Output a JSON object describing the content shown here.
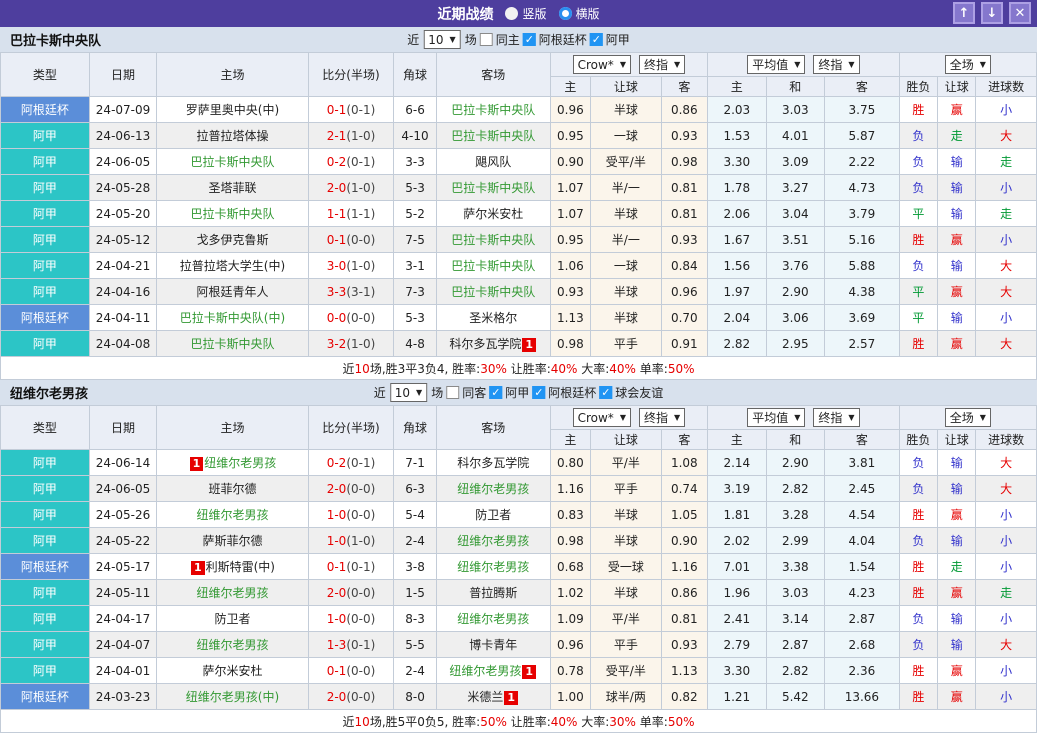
{
  "titlebar": {
    "title": "近期战绩",
    "radios": [
      {
        "label": "竖版",
        "selected": false
      },
      {
        "label": "横版",
        "selected": true
      }
    ],
    "buttons": {
      "up": "↑",
      "down": "↓",
      "close": "✕"
    }
  },
  "headers": {
    "type": "类型",
    "date": "日期",
    "home": "主场",
    "score": "比分(半场)",
    "corner": "角球",
    "away": "客场",
    "dd_company": "Crow*",
    "dd_final1": "终指",
    "dd_avg": "平均值",
    "dd_final2": "终指",
    "dd_scope": "全场",
    "ah_home": "主",
    "ah_line": "让球",
    "ah_away": "客",
    "eu_home": "主",
    "eu_draw": "和",
    "eu_away": "客",
    "wl": "胜负",
    "ahr": "让球",
    "goals": "进球数"
  },
  "league_labels": {
    "cup": "阿根廷杯",
    "lig": "阿甲"
  },
  "colors": {
    "titlebar": "#4e3e9e",
    "cup_badge": "#5b8ed9",
    "league_badge": "#2cc5c6",
    "self_team_green": "#339933",
    "score_red": "#e60000",
    "win_red": "#e60000",
    "draw_green": "#009933",
    "lose_blue": "#3333cc",
    "ah_col_bg": "#fbf5eb",
    "eu_col_bg": "#edf6fa",
    "band_bg": "#d8e1ed",
    "checkbox_blue": "#2094f3"
  },
  "sections": [
    {
      "team": "巴拉卡斯中央队",
      "controls": {
        "near": "近",
        "count": "10",
        "games": "场",
        "same": {
          "label": "同主",
          "checked": false
        },
        "leagues": [
          {
            "label": "阿根廷杯",
            "checked": true
          },
          {
            "label": "阿甲",
            "checked": true
          }
        ]
      },
      "rows": [
        {
          "lg": "cup",
          "date": "24-07-09",
          "home": {
            "n": "罗萨里奥中央(中)"
          },
          "ft": "0-1",
          "ht": "(0-1)",
          "corner": "6-6",
          "away": {
            "n": "巴拉卡斯中央队",
            "self": true
          },
          "ah": [
            "0.96",
            "半球",
            "0.86"
          ],
          "eu": [
            "2.03",
            "3.03",
            "3.75"
          ],
          "res": [
            [
              "胜",
              "red"
            ],
            [
              "赢",
              "red"
            ],
            [
              "小",
              "blue"
            ]
          ]
        },
        {
          "lg": "lig",
          "date": "24-06-13",
          "home": {
            "n": "拉普拉塔体操"
          },
          "ft": "2-1",
          "ht": "(1-0)",
          "corner": "4-10",
          "away": {
            "n": "巴拉卡斯中央队",
            "self": true
          },
          "ah": [
            "0.95",
            "一球",
            "0.93"
          ],
          "eu": [
            "1.53",
            "4.01",
            "5.87"
          ],
          "res": [
            [
              "负",
              "blue"
            ],
            [
              "走",
              "green"
            ],
            [
              "大",
              "red"
            ]
          ]
        },
        {
          "lg": "lig",
          "date": "24-06-05",
          "home": {
            "n": "巴拉卡斯中央队",
            "self": true
          },
          "ft": "0-2",
          "ht": "(0-1)",
          "corner": "3-3",
          "away": {
            "n": "飓风队"
          },
          "ah": [
            "0.90",
            "受平/半",
            "0.98"
          ],
          "eu": [
            "3.30",
            "3.09",
            "2.22"
          ],
          "res": [
            [
              "负",
              "blue"
            ],
            [
              "输",
              "blue"
            ],
            [
              "走",
              "green"
            ]
          ]
        },
        {
          "lg": "lig",
          "date": "24-05-28",
          "home": {
            "n": "圣塔菲联"
          },
          "ft": "2-0",
          "ht": "(1-0)",
          "corner": "5-3",
          "away": {
            "n": "巴拉卡斯中央队",
            "self": true
          },
          "ah": [
            "1.07",
            "半/一",
            "0.81"
          ],
          "eu": [
            "1.78",
            "3.27",
            "4.73"
          ],
          "res": [
            [
              "负",
              "blue"
            ],
            [
              "输",
              "blue"
            ],
            [
              "小",
              "blue"
            ]
          ]
        },
        {
          "lg": "lig",
          "date": "24-05-20",
          "home": {
            "n": "巴拉卡斯中央队",
            "self": true
          },
          "ft": "1-1",
          "ht": "(1-1)",
          "corner": "5-2",
          "away": {
            "n": "萨尔米安杜"
          },
          "ah": [
            "1.07",
            "半球",
            "0.81"
          ],
          "eu": [
            "2.06",
            "3.04",
            "3.79"
          ],
          "res": [
            [
              "平",
              "green"
            ],
            [
              "输",
              "blue"
            ],
            [
              "走",
              "green"
            ]
          ]
        },
        {
          "lg": "lig",
          "date": "24-05-12",
          "home": {
            "n": "戈多伊克鲁斯"
          },
          "ft": "0-1",
          "ht": "(0-0)",
          "corner": "7-5",
          "away": {
            "n": "巴拉卡斯中央队",
            "self": true
          },
          "ah": [
            "0.95",
            "半/一",
            "0.93"
          ],
          "eu": [
            "1.67",
            "3.51",
            "5.16"
          ],
          "res": [
            [
              "胜",
              "red"
            ],
            [
              "赢",
              "red"
            ],
            [
              "小",
              "blue"
            ]
          ]
        },
        {
          "lg": "lig",
          "date": "24-04-21",
          "home": {
            "n": "拉普拉塔大学生(中)"
          },
          "ft": "3-0",
          "ht": "(1-0)",
          "corner": "3-1",
          "away": {
            "n": "巴拉卡斯中央队",
            "self": true
          },
          "ah": [
            "1.06",
            "一球",
            "0.84"
          ],
          "eu": [
            "1.56",
            "3.76",
            "5.88"
          ],
          "res": [
            [
              "负",
              "blue"
            ],
            [
              "输",
              "blue"
            ],
            [
              "大",
              "red"
            ]
          ]
        },
        {
          "lg": "lig",
          "date": "24-04-16",
          "home": {
            "n": "阿根廷青年人"
          },
          "ft": "3-3",
          "ht": "(3-1)",
          "corner": "7-3",
          "away": {
            "n": "巴拉卡斯中央队",
            "self": true
          },
          "ah": [
            "0.93",
            "半球",
            "0.96"
          ],
          "eu": [
            "1.97",
            "2.90",
            "4.38"
          ],
          "res": [
            [
              "平",
              "green"
            ],
            [
              "赢",
              "red"
            ],
            [
              "大",
              "red"
            ]
          ]
        },
        {
          "lg": "cup",
          "date": "24-04-11",
          "home": {
            "n": "巴拉卡斯中央队(中)",
            "self": true
          },
          "ft": "0-0",
          "ht": "(0-0)",
          "corner": "5-3",
          "away": {
            "n": "圣米格尔"
          },
          "ah": [
            "1.13",
            "半球",
            "0.70"
          ],
          "eu": [
            "2.04",
            "3.06",
            "3.69"
          ],
          "res": [
            [
              "平",
              "green"
            ],
            [
              "输",
              "blue"
            ],
            [
              "小",
              "blue"
            ]
          ]
        },
        {
          "lg": "lig",
          "date": "24-04-08",
          "home": {
            "n": "巴拉卡斯中央队",
            "self": true
          },
          "ft": "3-2",
          "ht": "(1-0)",
          "corner": "4-8",
          "away": {
            "n": "科尔多瓦学院",
            "card": "1"
          },
          "ah": [
            "0.98",
            "平手",
            "0.91"
          ],
          "eu": [
            "2.82",
            "2.95",
            "2.57"
          ],
          "res": [
            [
              "胜",
              "red"
            ],
            [
              "赢",
              "red"
            ],
            [
              "大",
              "red"
            ]
          ]
        }
      ],
      "summary": [
        [
          "近"
        ],
        [
          "10",
          "red"
        ],
        [
          "场,胜3平3负4, 胜率:"
        ],
        [
          "30%",
          "red"
        ],
        [
          " 让胜率:"
        ],
        [
          "40%",
          "red"
        ],
        [
          " 大率:"
        ],
        [
          "40%",
          "red"
        ],
        [
          " 单率:"
        ],
        [
          "50%",
          "red"
        ]
      ]
    },
    {
      "team": "纽维尔老男孩",
      "controls": {
        "near": "近",
        "count": "10",
        "games": "场",
        "same": {
          "label": "同客",
          "checked": false
        },
        "leagues": [
          {
            "label": "阿甲",
            "checked": true
          },
          {
            "label": "阿根廷杯",
            "checked": true
          },
          {
            "label": "球会友谊",
            "checked": true
          }
        ]
      },
      "rows": [
        {
          "lg": "lig",
          "date": "24-06-14",
          "home": {
            "n": "纽维尔老男孩",
            "self": true,
            "card": "1"
          },
          "ft": "0-2",
          "ht": "(0-1)",
          "corner": "7-1",
          "away": {
            "n": "科尔多瓦学院"
          },
          "ah": [
            "0.80",
            "平/半",
            "1.08"
          ],
          "eu": [
            "2.14",
            "2.90",
            "3.81"
          ],
          "res": [
            [
              "负",
              "blue"
            ],
            [
              "输",
              "blue"
            ],
            [
              "大",
              "red"
            ]
          ]
        },
        {
          "lg": "lig",
          "date": "24-06-05",
          "home": {
            "n": "班菲尔德"
          },
          "ft": "2-0",
          "ht": "(0-0)",
          "corner": "6-3",
          "away": {
            "n": "纽维尔老男孩",
            "self": true
          },
          "ah": [
            "1.16",
            "平手",
            "0.74"
          ],
          "eu": [
            "3.19",
            "2.82",
            "2.45"
          ],
          "res": [
            [
              "负",
              "blue"
            ],
            [
              "输",
              "blue"
            ],
            [
              "大",
              "red"
            ]
          ]
        },
        {
          "lg": "lig",
          "date": "24-05-26",
          "home": {
            "n": "纽维尔老男孩",
            "self": true
          },
          "ft": "1-0",
          "ht": "(0-0)",
          "corner": "5-4",
          "away": {
            "n": "防卫者"
          },
          "ah": [
            "0.83",
            "半球",
            "1.05"
          ],
          "eu": [
            "1.81",
            "3.28",
            "4.54"
          ],
          "res": [
            [
              "胜",
              "red"
            ],
            [
              "赢",
              "red"
            ],
            [
              "小",
              "blue"
            ]
          ]
        },
        {
          "lg": "lig",
          "date": "24-05-22",
          "home": {
            "n": "萨斯菲尔德"
          },
          "ft": "1-0",
          "ht": "(1-0)",
          "corner": "2-4",
          "away": {
            "n": "纽维尔老男孩",
            "self": true
          },
          "ah": [
            "0.98",
            "半球",
            "0.90"
          ],
          "eu": [
            "2.02",
            "2.99",
            "4.04"
          ],
          "res": [
            [
              "负",
              "blue"
            ],
            [
              "输",
              "blue"
            ],
            [
              "小",
              "blue"
            ]
          ]
        },
        {
          "lg": "cup",
          "date": "24-05-17",
          "home": {
            "n": "利斯特雷(中)",
            "card": "1"
          },
          "ft": "0-1",
          "ht": "(0-1)",
          "corner": "3-8",
          "away": {
            "n": "纽维尔老男孩",
            "self": true
          },
          "ah": [
            "0.68",
            "受一球",
            "1.16"
          ],
          "eu": [
            "7.01",
            "3.38",
            "1.54"
          ],
          "res": [
            [
              "胜",
              "red"
            ],
            [
              "走",
              "green"
            ],
            [
              "小",
              "blue"
            ]
          ]
        },
        {
          "lg": "lig",
          "date": "24-05-11",
          "home": {
            "n": "纽维尔老男孩",
            "self": true
          },
          "ft": "2-0",
          "ht": "(0-0)",
          "corner": "1-5",
          "away": {
            "n": "普拉腾斯"
          },
          "ah": [
            "1.02",
            "半球",
            "0.86"
          ],
          "eu": [
            "1.96",
            "3.03",
            "4.23"
          ],
          "res": [
            [
              "胜",
              "red"
            ],
            [
              "赢",
              "red"
            ],
            [
              "走",
              "green"
            ]
          ]
        },
        {
          "lg": "lig",
          "date": "24-04-17",
          "home": {
            "n": "防卫者"
          },
          "ft": "1-0",
          "ht": "(0-0)",
          "corner": "8-3",
          "away": {
            "n": "纽维尔老男孩",
            "self": true
          },
          "ah": [
            "1.09",
            "平/半",
            "0.81"
          ],
          "eu": [
            "2.41",
            "3.14",
            "2.87"
          ],
          "res": [
            [
              "负",
              "blue"
            ],
            [
              "输",
              "blue"
            ],
            [
              "小",
              "blue"
            ]
          ]
        },
        {
          "lg": "lig",
          "date": "24-04-07",
          "home": {
            "n": "纽维尔老男孩",
            "self": true
          },
          "ft": "1-3",
          "ht": "(0-1)",
          "corner": "5-5",
          "away": {
            "n": "博卡青年"
          },
          "ah": [
            "0.96",
            "平手",
            "0.93"
          ],
          "eu": [
            "2.79",
            "2.87",
            "2.68"
          ],
          "res": [
            [
              "负",
              "blue"
            ],
            [
              "输",
              "blue"
            ],
            [
              "大",
              "red"
            ]
          ]
        },
        {
          "lg": "lig",
          "date": "24-04-01",
          "home": {
            "n": "萨尔米安杜"
          },
          "ft": "0-1",
          "ht": "(0-0)",
          "corner": "2-4",
          "away": {
            "n": "纽维尔老男孩",
            "self": true,
            "card": "1"
          },
          "ah": [
            "0.78",
            "受平/半",
            "1.13"
          ],
          "eu": [
            "3.30",
            "2.82",
            "2.36"
          ],
          "res": [
            [
              "胜",
              "red"
            ],
            [
              "赢",
              "red"
            ],
            [
              "小",
              "blue"
            ]
          ]
        },
        {
          "lg": "cup",
          "date": "24-03-23",
          "home": {
            "n": "纽维尔老男孩(中)",
            "self": true
          },
          "ft": "2-0",
          "ht": "(0-0)",
          "corner": "8-0",
          "away": {
            "n": "米德兰",
            "card": "1"
          },
          "ah": [
            "1.00",
            "球半/两",
            "0.82"
          ],
          "eu": [
            "1.21",
            "5.42",
            "13.66"
          ],
          "res": [
            [
              "胜",
              "red"
            ],
            [
              "赢",
              "red"
            ],
            [
              "小",
              "blue"
            ]
          ]
        }
      ],
      "summary": [
        [
          "近"
        ],
        [
          "10",
          "red"
        ],
        [
          "场,胜5平0负5, 胜率:"
        ],
        [
          "50%",
          "red"
        ],
        [
          " 让胜率:"
        ],
        [
          "40%",
          "red"
        ],
        [
          " 大率:"
        ],
        [
          "30%",
          "red"
        ],
        [
          " 单率:"
        ],
        [
          "50%",
          "red"
        ]
      ]
    }
  ]
}
